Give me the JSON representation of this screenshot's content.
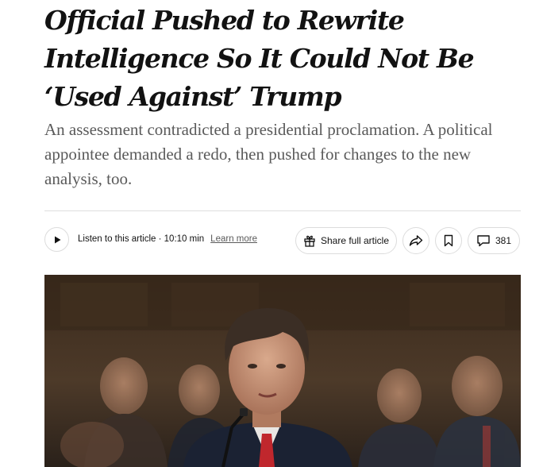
{
  "article": {
    "headline": "Official Pushed to Rewrite Intelligence So It Could Not Be ‘Used Against’ Trump",
    "summary": "An assessment contradicted a presidential proclamation. A political appointee demanded a redo, then pushed for changes to the new analysis, too."
  },
  "toolbar": {
    "listen_label": "Listen to this article · 10:10 min",
    "learn_more": "Learn more",
    "share_label": "Share full article",
    "comments_count": "381"
  },
  "icons": {
    "play": "play-icon",
    "gift": "gift-icon",
    "share": "share-arrow-icon",
    "save": "bookmark-icon",
    "comments": "comment-bubble-icon"
  },
  "colors": {
    "headline": "#121212",
    "summary": "#5a5a5a",
    "border": "#dcdcdc",
    "tie": "#c0272d"
  }
}
